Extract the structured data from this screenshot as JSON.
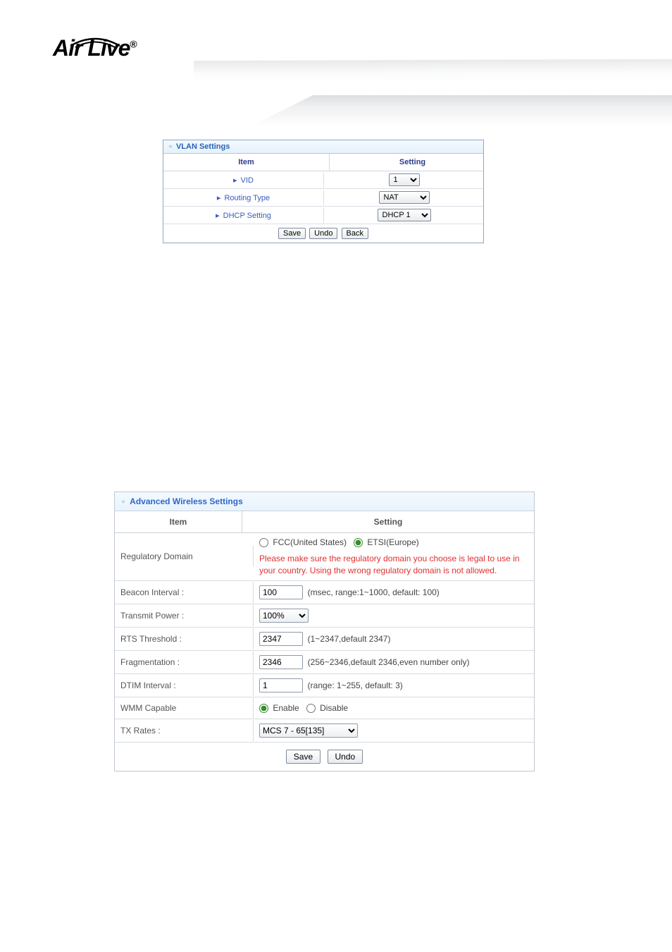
{
  "brand": {
    "name": "Air Live",
    "reg": "®"
  },
  "vlan": {
    "title": "VLAN Settings",
    "item_header": "Item",
    "setting_header": "Setting",
    "rows": {
      "vid": {
        "label": "VID",
        "value": "1"
      },
      "routing": {
        "label": "Routing Type",
        "value": "NAT"
      },
      "dhcp": {
        "label": "DHCP Setting",
        "value": "DHCP 1"
      }
    },
    "buttons": {
      "save": "Save",
      "undo": "Undo",
      "back": "Back"
    }
  },
  "adv": {
    "title": "Advanced Wireless Settings",
    "item_header": "Item",
    "setting_header": "Setting",
    "reg_domain": {
      "label": "Regulatory Domain",
      "fcc": "FCC(United States)",
      "etsi": "ETSI(Europe)",
      "selected": "etsi",
      "warning": "Please make sure the regulatory domain you choose is legal to use in your country. Using the wrong regulatory domain is not allowed."
    },
    "beacon": {
      "label": "Beacon Interval :",
      "value": "100",
      "hint": "(msec, range:1~1000, default: 100)"
    },
    "txpower": {
      "label": "Transmit Power :",
      "value": "100%"
    },
    "rts": {
      "label": "RTS Threshold :",
      "value": "2347",
      "hint": "(1~2347,default 2347)"
    },
    "frag": {
      "label": "Fragmentation :",
      "value": "2346",
      "hint": "(256~2346,default 2346,even number only)"
    },
    "dtim": {
      "label": "DTIM Interval :",
      "value": "1",
      "hint": "(range: 1~255, default: 3)"
    },
    "wmm": {
      "label": "WMM Capable",
      "enable": "Enable",
      "disable": "Disable",
      "selected": "enable"
    },
    "txrates": {
      "label": "TX Rates :",
      "value": "MCS 7 - 65[135]"
    },
    "buttons": {
      "save": "Save",
      "undo": "Undo"
    }
  }
}
